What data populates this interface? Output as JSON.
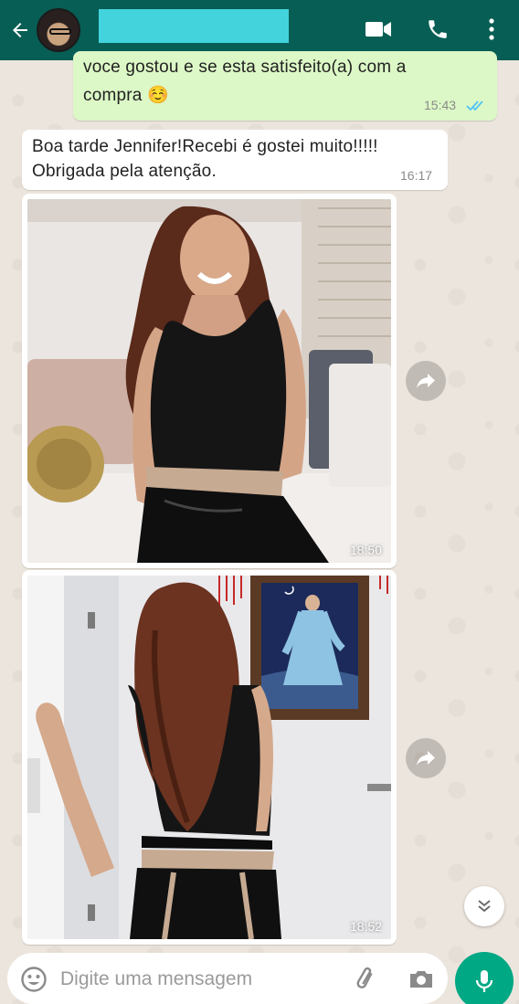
{
  "header": {
    "back_icon": "arrow-left-icon",
    "video_icon": "video-call-icon",
    "call_icon": "phone-icon",
    "menu_icon": "more-vert-icon",
    "contact_name_redacted_color": "#42d3dc"
  },
  "messages": [
    {
      "direction": "outgoing",
      "text_line1": "voce gostou e se esta satisfeito(a) com a",
      "text_line2": "compra ☺️",
      "time": "15:43",
      "status": "read"
    },
    {
      "direction": "incoming",
      "text_line1": "Boa tarde Jennifer!Recebi é gostei muito!!!!!",
      "text_line2": "Obrigada pela atenção.",
      "time": "16:17"
    },
    {
      "direction": "incoming",
      "type": "photo",
      "description_icon": "photo-woman-seated",
      "time": "18:50"
    },
    {
      "direction": "incoming",
      "type": "photo",
      "description_icon": "photo-woman-back",
      "time": "18:52"
    }
  ],
  "composer": {
    "placeholder": "Digite uma mensagem",
    "emoji_icon": "emoji-icon",
    "attach_icon": "paperclip-icon",
    "camera_icon": "camera-icon",
    "mic_icon": "mic-icon"
  },
  "colors": {
    "header": "#075e54",
    "outgoing_bubble": "#dcf8c6",
    "incoming_bubble": "#ffffff",
    "read_ticks": "#4fc3f7",
    "mic_button": "#00a884"
  }
}
